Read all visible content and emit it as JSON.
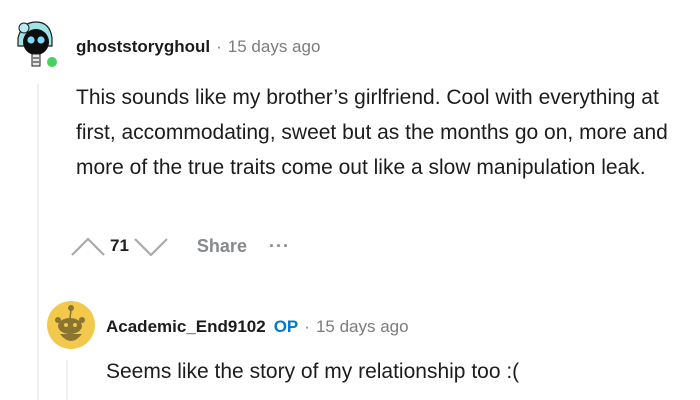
{
  "comment": {
    "author": "ghoststoryghoul",
    "separator": "·",
    "time": "15 days ago",
    "body": "This sounds like my brother’s girlfriend. Cool with everything at first, accommodating, sweet but as the months go on, more and more of the true traits come out like a slow manipulation leak.",
    "vote_count": "71",
    "share_label": "Share",
    "more_label": "···"
  },
  "reply": {
    "author": "Academic_End9102",
    "badge": "OP",
    "separator": "·",
    "time": "15 days ago",
    "body": "Seems like the story of my relationship too :("
  },
  "colors": {
    "op_badge": "#0079d3",
    "meta_gray": "#7c7c7c",
    "reply_avatar_bg": "#f2c94c",
    "online_dot": "#46d160"
  }
}
